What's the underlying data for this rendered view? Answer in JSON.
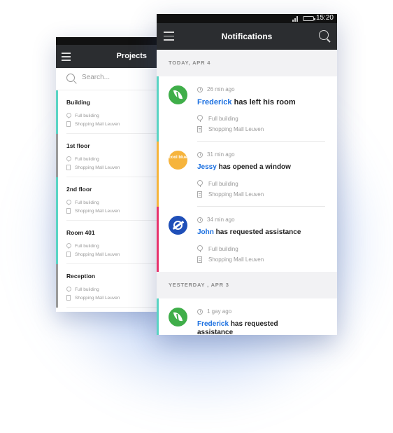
{
  "projects": {
    "title": "Projects",
    "search_placeholder": "Search...",
    "items": [
      {
        "name": "Building",
        "scope": "Full building",
        "location": "Shopping Mall Leuven",
        "accent": "#5ad4c4"
      },
      {
        "name": "1st floor",
        "scope": "Full building",
        "location": "Shopping Mall Leuven",
        "accent": "#9a9a9a"
      },
      {
        "name": "2nd floor",
        "scope": "Full building",
        "location": "Shopping Mall Leuven",
        "accent": "#5ad4c4"
      },
      {
        "name": "Room 401",
        "scope": "Full building",
        "location": "Shopping Mall Leuven",
        "accent": "#5ad4c4"
      },
      {
        "name": "Reception",
        "scope": "Full building",
        "location": "Shopping Mall Leuven",
        "accent": "#9a9a9a"
      }
    ]
  },
  "notifications": {
    "status_time": "15:20",
    "title": "Notifications",
    "sections": [
      {
        "label": "TODAY, APR 4",
        "items": [
          {
            "time": "26 min ago",
            "who": "Frederick",
            "action": "has left his room",
            "scope": "Full building",
            "location": "Shopping Mall Leuven",
            "accent": "#5ad4c4",
            "avatar": "leaf-logo"
          },
          {
            "time": "31 min ago",
            "who": "Jessy",
            "action": "has opened a window",
            "scope": "Full building",
            "location": "Shopping Mall Leuven",
            "accent": "#f6b43c",
            "avatar": "coolblue-logo",
            "avatar_text": "cool blue"
          },
          {
            "time": "34 min ago",
            "who": "John",
            "action": "has requested assistance",
            "scope": "Full building",
            "location": "Shopping Mall Leuven",
            "accent": "#e8336d",
            "avatar": "planet-logo"
          }
        ]
      },
      {
        "label": "YESTERDAY , APR 3",
        "items": [
          {
            "time": "1 gay ago",
            "who": "Frederick",
            "action": "has requested assistance",
            "accent": "#5ad4c4",
            "avatar": "leaf-logo"
          }
        ]
      }
    ]
  }
}
